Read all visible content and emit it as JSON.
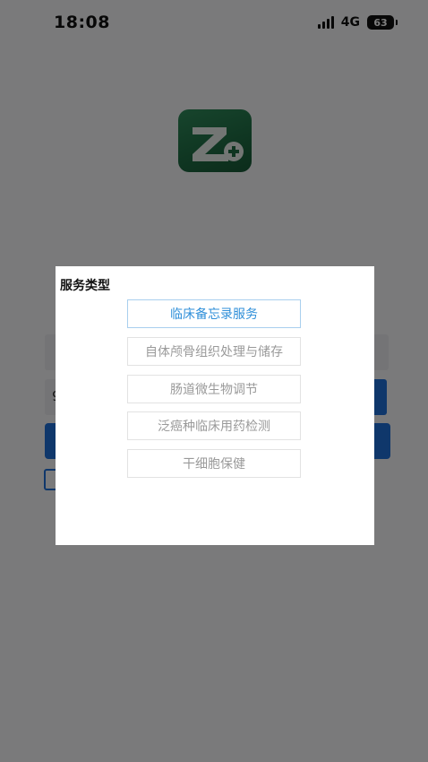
{
  "status_bar": {
    "time": "18:08",
    "network": "4G",
    "battery": "63"
  },
  "app": {
    "logo_icon": "z-plus-logo-icon",
    "brand_color": "#1e6b43",
    "accent_color": "#1e6ed6"
  },
  "login_form": {
    "code_field_partial_text": "9"
  },
  "dialog": {
    "title": "服务类型",
    "selected_index": 0,
    "options": [
      {
        "label": "临床备忘录服务"
      },
      {
        "label": "自体颅骨组织处理与储存"
      },
      {
        "label": "肠道微生物调节"
      },
      {
        "label": "泛癌种临床用药检测"
      },
      {
        "label": "干细胞保健"
      }
    ],
    "selected_color": "#2f8fd9"
  }
}
